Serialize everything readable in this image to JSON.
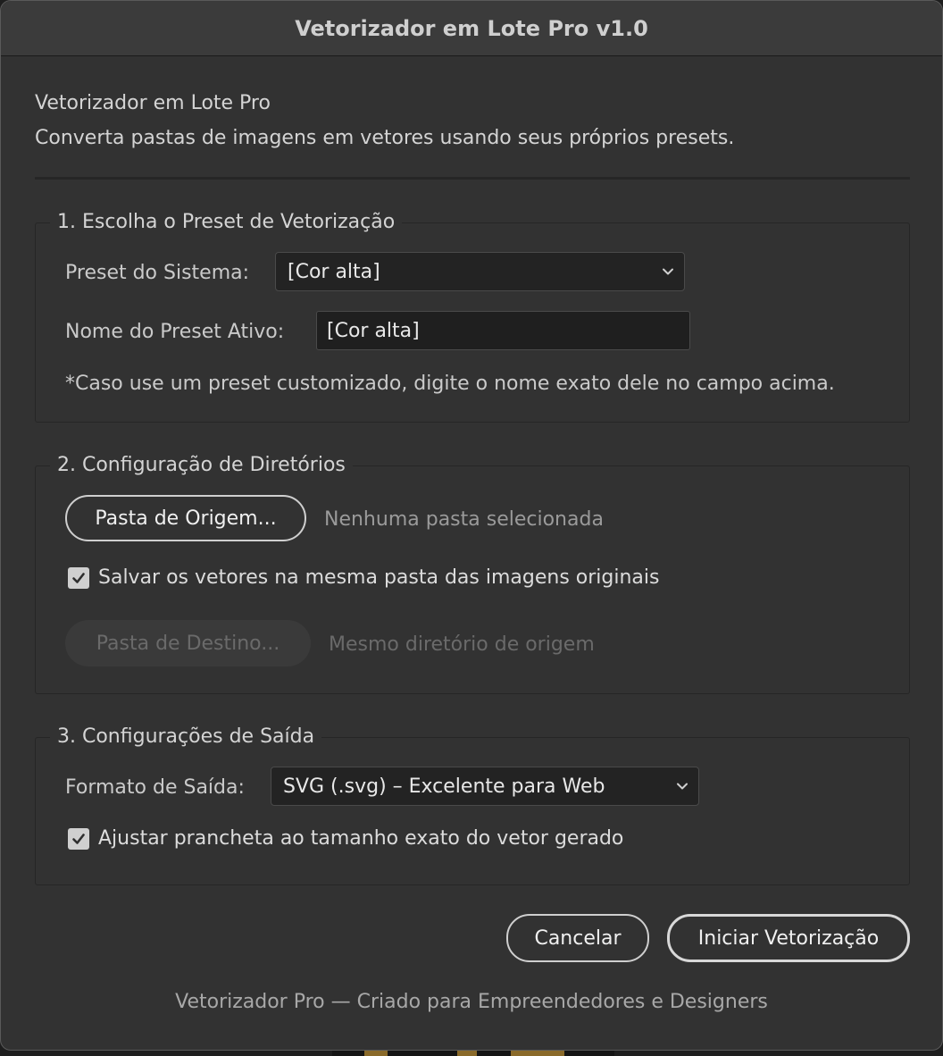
{
  "window": {
    "title": "Vetorizador em Lote Pro v1.0"
  },
  "intro": {
    "title": "Vetorizador em Lote Pro",
    "description": "Converta pastas de imagens em vetores usando seus próprios presets."
  },
  "preset_section": {
    "title": "1. Escolha o Preset de Vetorização",
    "system_preset_label": "Preset do Sistema:",
    "system_preset_value": "[Cor alta]",
    "active_name_label": "Nome do Preset Ativo:",
    "active_name_value": "[Cor alta]",
    "note": "*Caso use um preset customizado, digite o nome exato dele no campo acima."
  },
  "directories_section": {
    "title": "2. Configuração de Diretórios",
    "source_button": "Pasta de Origem...",
    "source_status": "Nenhuma pasta selecionada",
    "same_folder_checkbox": "Salvar os vetores na mesma pasta das imagens originais",
    "same_folder_checked": true,
    "dest_button": "Pasta de Destino...",
    "dest_status": "Mesmo diretório de origem"
  },
  "output_section": {
    "title": "3. Configurações de Saída",
    "format_label": "Formato de Saída:",
    "format_value": "SVG (.svg) – Excelente para Web",
    "fit_artboard_checkbox": "Ajustar prancheta ao tamanho exato do vetor gerado",
    "fit_artboard_checked": true
  },
  "actions": {
    "cancel": "Cancelar",
    "start": "Iniciar Vetorização"
  },
  "footer": {
    "text": "Vetorizador Pro — Criado para Empreendedores e Designers"
  },
  "colors": {
    "window_bg": "#323232",
    "titlebar_bg": "#3b3b3b",
    "field_bg": "#232323",
    "checkbox": "#cfcfcf"
  },
  "icons": {
    "dropdown": "chevron-down-icon",
    "checkbox": "checkmark-icon"
  }
}
